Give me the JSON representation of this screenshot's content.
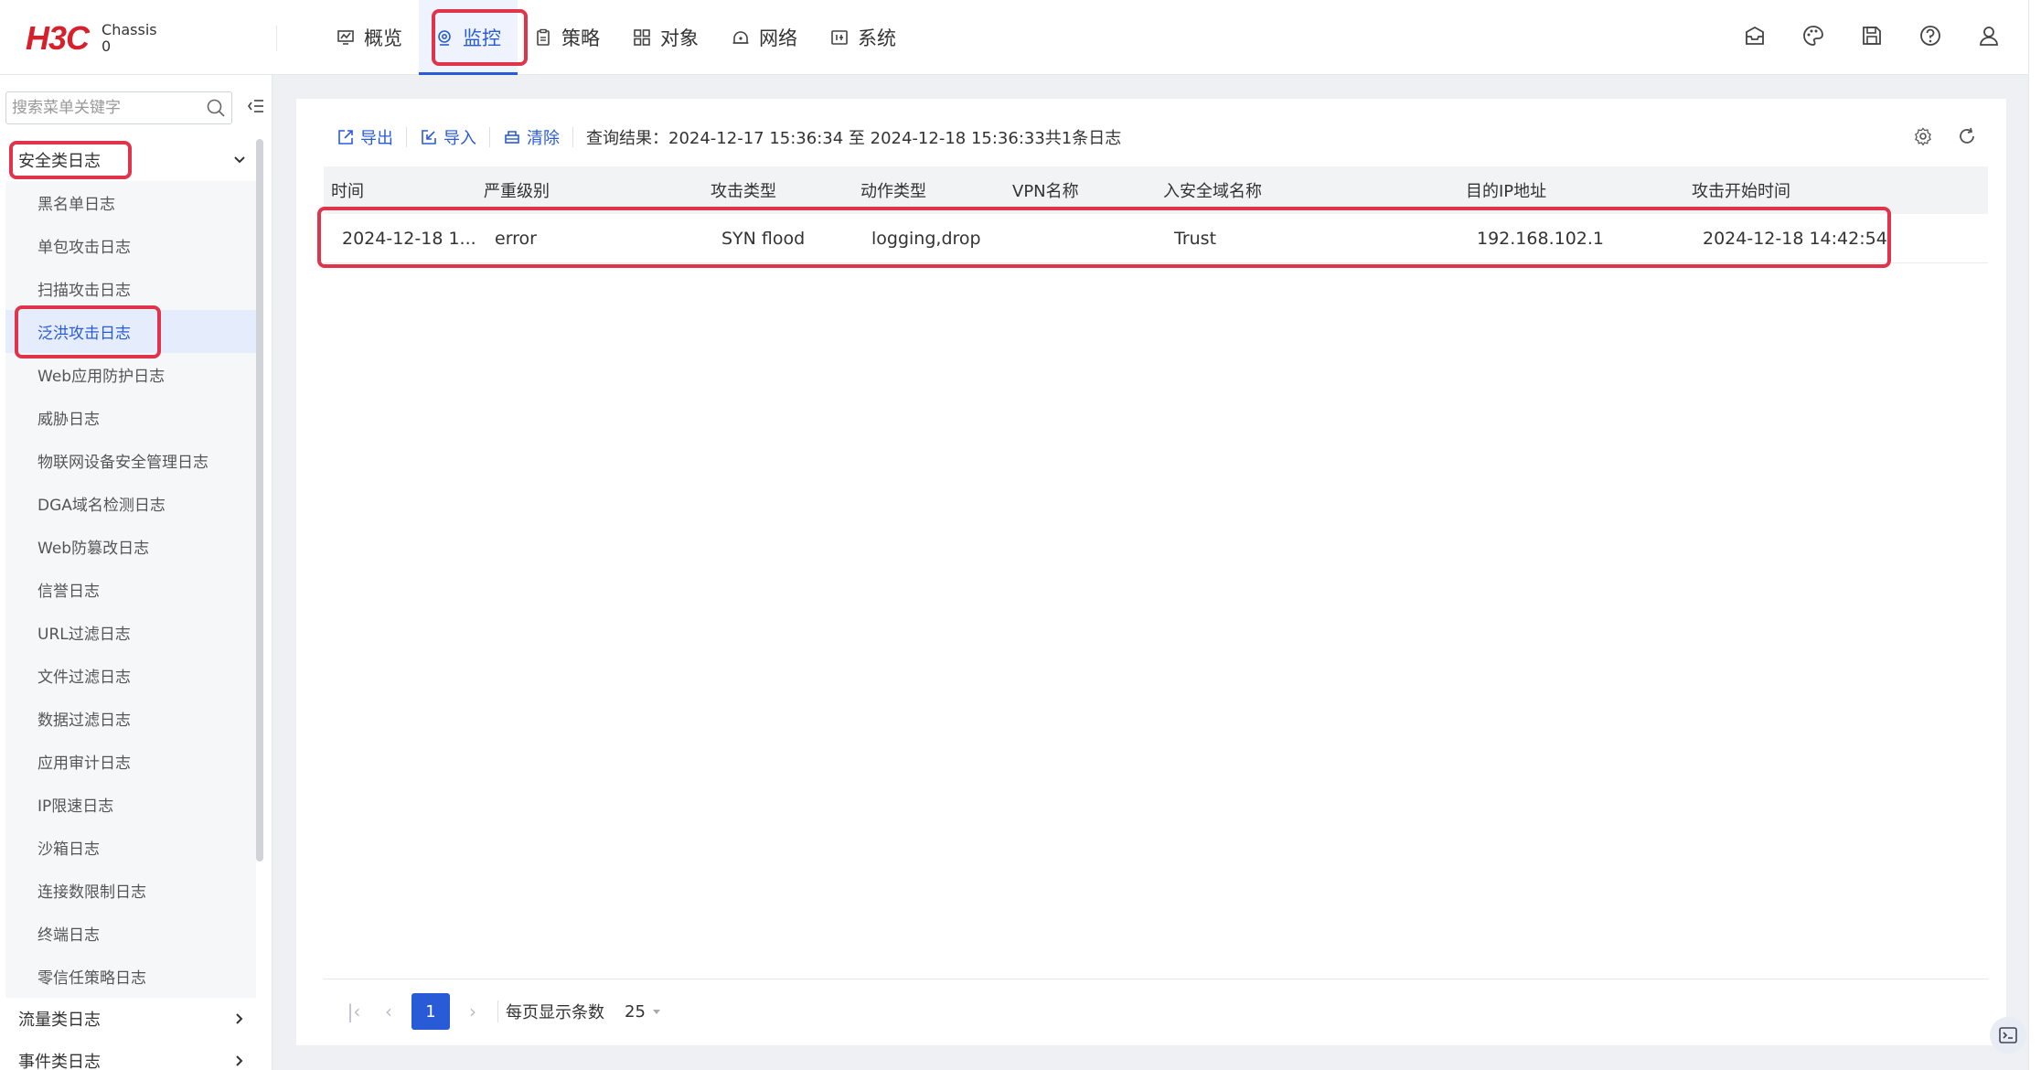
{
  "header": {
    "logo": "H3C",
    "device_line1": "Chassis",
    "device_line2": "0",
    "nav": [
      {
        "label": "概览",
        "icon": "overview-icon"
      },
      {
        "label": "监控",
        "icon": "monitor-icon"
      },
      {
        "label": "策略",
        "icon": "policy-icon"
      },
      {
        "label": "对象",
        "icon": "object-icon"
      },
      {
        "label": "网络",
        "icon": "network-icon"
      },
      {
        "label": "系统",
        "icon": "system-icon"
      }
    ],
    "active_nav": "监控",
    "accent_color": "#2a5bd7",
    "highlight_color": "#e0344a"
  },
  "sidebar": {
    "search_placeholder": "搜索菜单关键字",
    "groups": [
      {
        "label": "安全类日志",
        "expanded": true
      },
      {
        "label": "流量类日志",
        "expanded": false
      },
      {
        "label": "事件类日志",
        "expanded": false
      }
    ],
    "items": [
      "黑名单日志",
      "单包攻击日志",
      "扫描攻击日志",
      "泛洪攻击日志",
      "Web应用防护日志",
      "威胁日志",
      "物联网设备安全管理日志",
      "DGA域名检测日志",
      "Web防篡改日志",
      "信誉日志",
      "URL过滤日志",
      "文件过滤日志",
      "数据过滤日志",
      "应用审计日志",
      "IP限速日志",
      "沙箱日志",
      "连接数限制日志",
      "终端日志",
      "零信任策略日志"
    ],
    "active_item": "泛洪攻击日志"
  },
  "toolbar": {
    "export_label": "导出",
    "import_label": "导入",
    "clear_label": "清除",
    "query_result": "查询结果：2024-12-17 15:36:34 至 2024-12-18 15:36:33共1条日志"
  },
  "table": {
    "columns": [
      "时间",
      "严重级别",
      "攻击类型",
      "动作类型",
      "VPN名称",
      "入安全域名称",
      "目的IP地址",
      "攻击开始时间"
    ],
    "rows": [
      [
        "2024-12-18 1...",
        "error",
        "SYN flood",
        "logging,drop",
        "",
        "Trust",
        "192.168.102.1",
        "2024-12-18 14:42:54"
      ]
    ]
  },
  "pagination": {
    "current_page": "1",
    "page_size_label": "每页显示条数",
    "page_size": "25"
  }
}
